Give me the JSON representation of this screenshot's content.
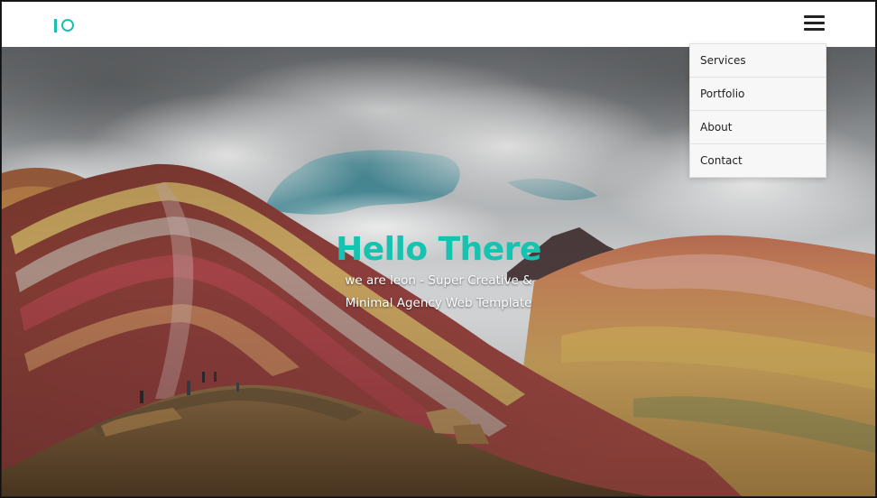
{
  "header": {
    "logo_icon": "io-logo-icon",
    "menu_icon": "hamburger-menu-icon"
  },
  "menu": {
    "items": [
      {
        "label": "Services"
      },
      {
        "label": "Portfolio"
      },
      {
        "label": "About"
      },
      {
        "label": "Contact"
      }
    ]
  },
  "hero": {
    "title": "Hello There",
    "subtitle": "we are leon - Super Creative & Minimal Agency Web Template",
    "background": "rainbow-mountain-photo"
  },
  "colors": {
    "accent": "#16c3b0",
    "navbar_bg": "#ffffff",
    "dropdown_bg": "#f7f7f7"
  }
}
